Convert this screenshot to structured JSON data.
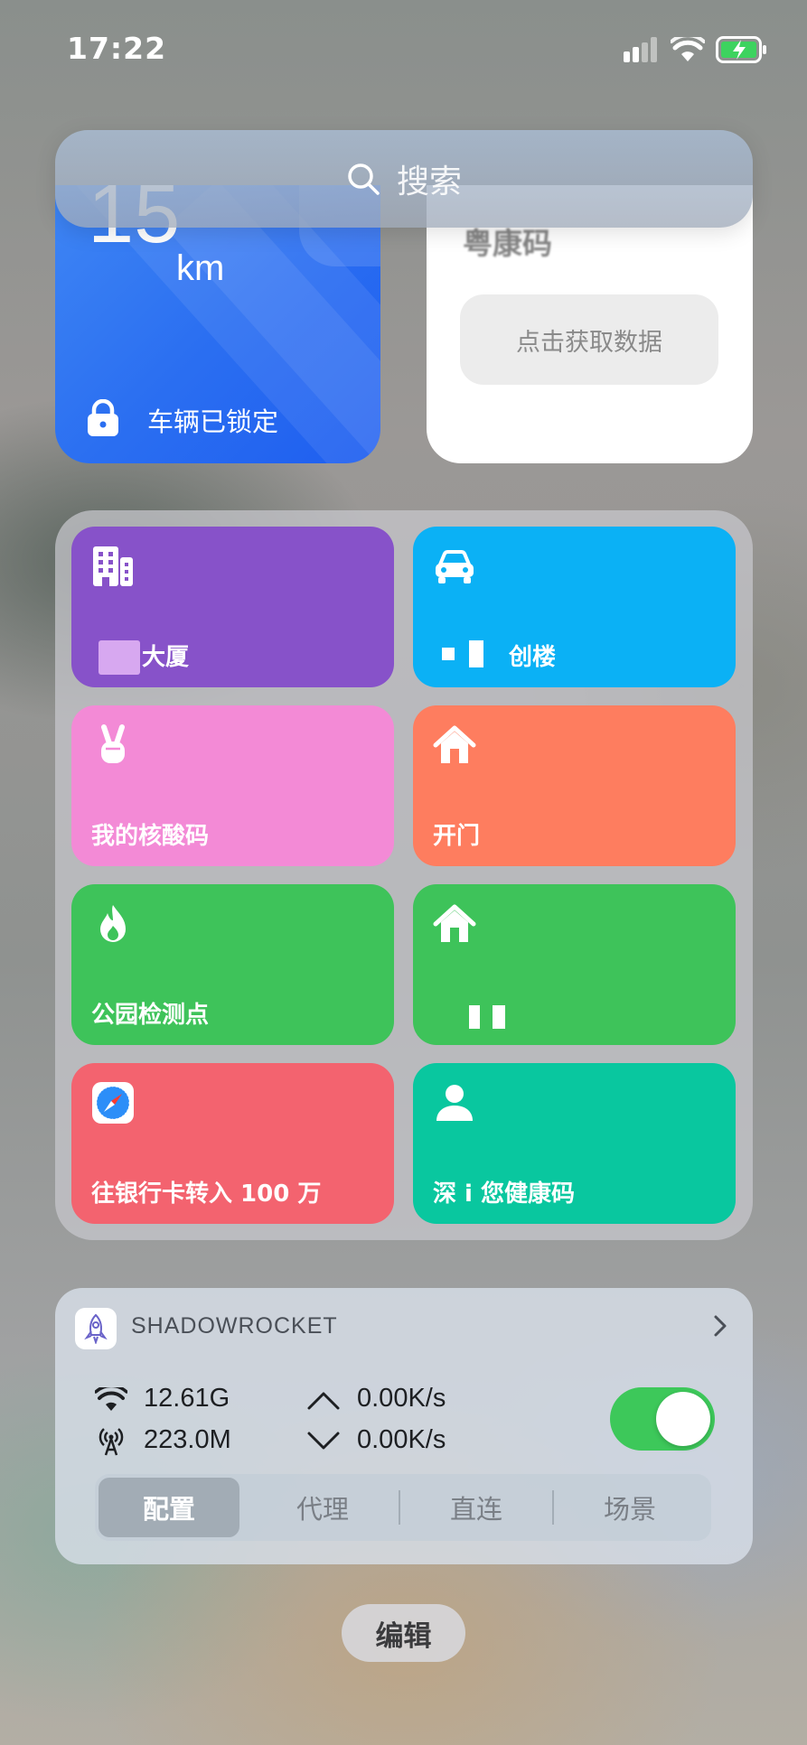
{
  "status_bar": {
    "time": "17:22"
  },
  "search": {
    "placeholder": "搜索"
  },
  "car_widget": {
    "distance": "15",
    "unit": "km",
    "status": "车辆已锁定"
  },
  "health_widget": {
    "title": "粤康码",
    "button": "点击获取数据"
  },
  "shortcuts": [
    {
      "label": "大厦",
      "color": "#8752c9",
      "icon": "building-icon"
    },
    {
      "label": "创楼",
      "color": "#0bb1f5",
      "icon": "car-icon"
    },
    {
      "label": "我的核酸码",
      "color": "#f38ad6",
      "icon": "victory-hand-icon"
    },
    {
      "label": "开门",
      "color": "#fe7d5f",
      "icon": "home-icon"
    },
    {
      "label": "公园检测点",
      "color": "#3ec35a",
      "icon": "flame-icon"
    },
    {
      "label": "",
      "color": "#3ec35a",
      "icon": "home-icon"
    },
    {
      "label": "往银行卡转入 100 万",
      "color": "#f3636f",
      "icon": "safari-compass-icon"
    },
    {
      "label": "深 i 您健康码",
      "color": "#09c79f",
      "icon": "person-icon"
    }
  ],
  "shadowrocket": {
    "name": "SHADOWROCKET",
    "wifi_traffic": "12.61G",
    "cellular_traffic": "223.0M",
    "upload_speed": "0.00K/s",
    "download_speed": "0.00K/s",
    "enabled": true,
    "tabs": [
      "配置",
      "代理",
      "直连",
      "场景"
    ],
    "active_tab": "配置"
  },
  "edit_button": "编辑",
  "colors": {
    "toggle_on": "#3dc85a",
    "car_widget": "#2b6ff1"
  }
}
